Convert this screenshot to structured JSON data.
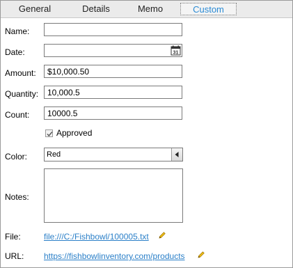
{
  "tabs": [
    {
      "label": "General"
    },
    {
      "label": "Details"
    },
    {
      "label": "Memo"
    },
    {
      "label": "Custom",
      "active": true
    }
  ],
  "form": {
    "name": {
      "label": "Name:",
      "value": ""
    },
    "date": {
      "label": "Date:",
      "value": "",
      "calendar_day": "31"
    },
    "amount": {
      "label": "Amount:",
      "value": "$10,000.50"
    },
    "quantity": {
      "label": "Quantity:",
      "value": "10,000.5"
    },
    "count": {
      "label": "Count:",
      "value": "10000.5"
    },
    "approved": {
      "label": "Approved",
      "checked": true
    },
    "color": {
      "label": "Color:",
      "value": "Red"
    },
    "notes": {
      "label": "Notes:",
      "value": ""
    },
    "file": {
      "label": "File:",
      "value": "file:///C:/Fishbowl/100005.txt"
    },
    "url": {
      "label": "URL:",
      "value": "https://fishbowlinventory.com/products"
    }
  },
  "icons": {
    "calendar": "calendar-icon",
    "checkbox": "checkmark-icon",
    "dropdown": "triangle-left-icon",
    "edit": "pencil-icon"
  },
  "colors": {
    "accent": "#2a8ad4",
    "link": "#2a7fc8",
    "tab_bar": "#ebebeb",
    "pencil": "#e0a800"
  }
}
